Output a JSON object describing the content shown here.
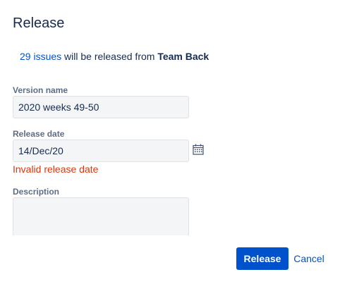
{
  "dialog": {
    "title": "Release",
    "summary": {
      "issues_link": "29 issues",
      "middle_text": " will be released from ",
      "team_name": "Team Back"
    }
  },
  "form": {
    "version_name": {
      "label": "Version name",
      "value": "2020 weeks 49-50"
    },
    "release_date": {
      "label": "Release date",
      "value": "14/Dec/20",
      "error": "Invalid release date",
      "icon": "calendar-icon"
    },
    "description": {
      "label": "Description",
      "value": ""
    }
  },
  "actions": {
    "release_label": "Release",
    "cancel_label": "Cancel"
  },
  "colors": {
    "primary": "#0052cc",
    "error": "#de350b",
    "text": "#172b4d",
    "label": "#5e6c84",
    "field_bg": "#f4f5f7"
  }
}
